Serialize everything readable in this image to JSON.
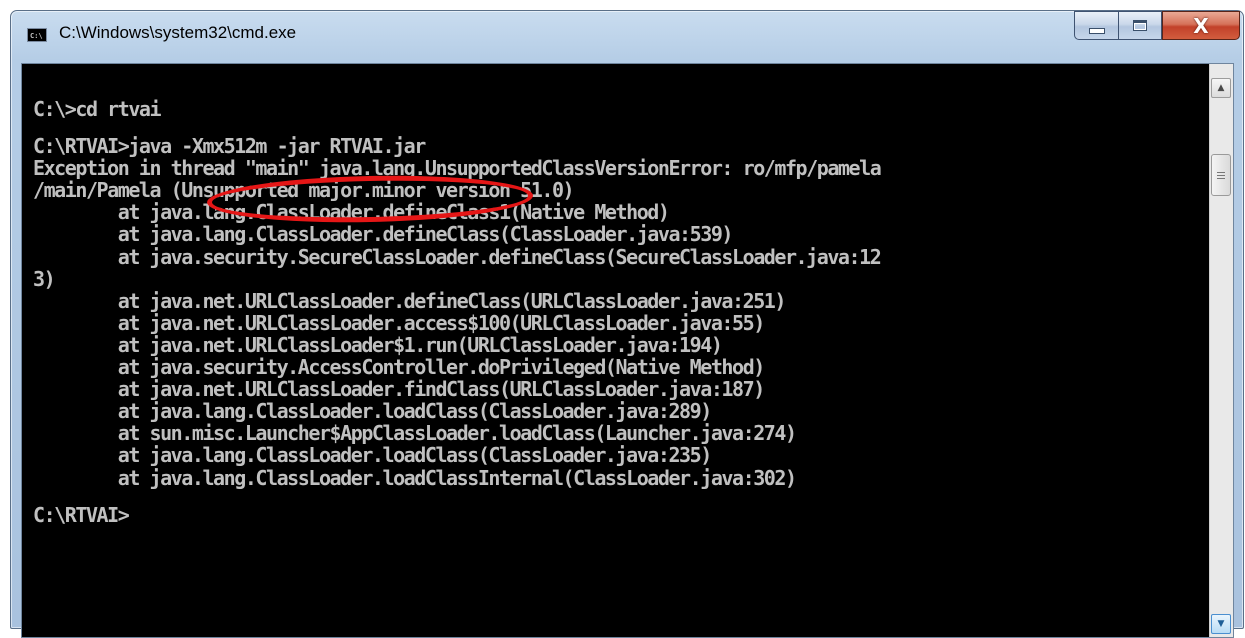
{
  "window": {
    "title": "C:\\Windows\\system32\\cmd.exe",
    "icon": "console-app-icon",
    "icon_text": "C:\\"
  },
  "caption_buttons": {
    "minimize": "minimize-icon",
    "maximize": "maximize-icon",
    "close_glyph": "X"
  },
  "console": {
    "lines": [
      "C:\\>cd rtvai",
      "",
      "C:\\RTVAI>java -Xmx512m -jar RTVAI.jar",
      "Exception in thread \"main\" java.lang.UnsupportedClassVersionError: ro/mfp/pamela",
      "/main/Pamela (Unsupported major.minor version 51.0)",
      "        at java.lang.ClassLoader.defineClass1(Native Method)",
      "        at java.lang.ClassLoader.defineClass(ClassLoader.java:539)",
      "        at java.security.SecureClassLoader.defineClass(SecureClassLoader.java:12",
      "3)",
      "        at java.net.URLClassLoader.defineClass(URLClassLoader.java:251)",
      "        at java.net.URLClassLoader.access$100(URLClassLoader.java:55)",
      "        at java.net.URLClassLoader$1.run(URLClassLoader.java:194)",
      "        at java.security.AccessController.doPrivileged(Native Method)",
      "        at java.net.URLClassLoader.findClass(URLClassLoader.java:187)",
      "        at java.lang.ClassLoader.loadClass(ClassLoader.java:289)",
      "        at sun.misc.Launcher$AppClassLoader.loadClass(Launcher.java:274)",
      "        at java.lang.ClassLoader.loadClass(ClassLoader.java:235)",
      "        at java.lang.ClassLoader.loadClassInternal(ClassLoader.java:302)",
      "",
      "C:\\RTVAI>"
    ]
  },
  "annotation": {
    "type": "red-ellipse",
    "target_text": "(Unsupported major.minor version 51",
    "color": "#e51616"
  },
  "colors": {
    "console_background": "#000000",
    "console_text": "#c0c0c0",
    "close_button": "#c2412a"
  }
}
